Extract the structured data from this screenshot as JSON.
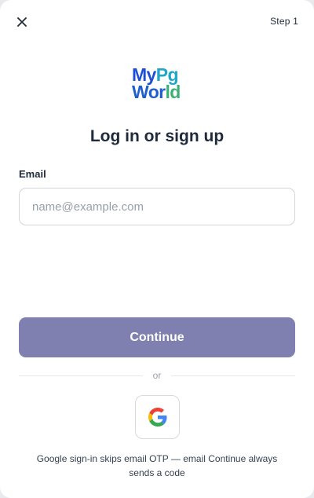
{
  "header": {
    "close_icon": "close-icon",
    "step": "Step 1"
  },
  "logo": {
    "line1_a": "My",
    "line1_b": "Pg",
    "line2_a": "Wor",
    "line2_b": "ld"
  },
  "form": {
    "title": "Log in or sign up",
    "email_label": "Email",
    "email_value": "",
    "email_placeholder": "name@example.com",
    "continue_label": "Continue"
  },
  "divider": {
    "text": "or"
  },
  "social": {
    "google_icon": "google-icon"
  },
  "note": "Google sign-in skips email OTP — email Continue always sends a code",
  "colors": {
    "continue_button": "#7f7fb0",
    "title_text": "#1f2a3c",
    "logo_blue": "#1d4ed8",
    "logo_cyan": "#1fa6c9",
    "logo_green": "#3bb273"
  }
}
